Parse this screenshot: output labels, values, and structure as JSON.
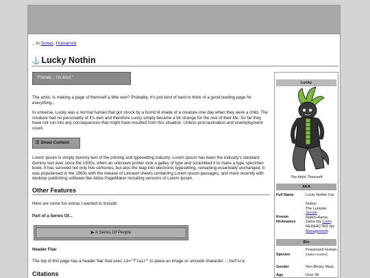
{
  "breadcrumb": {
    "prefix": "...In",
    "links": [
      "Sonas",
      "Humanoid"
    ],
    "separator": ","
  },
  "page": {
    "title": "Lucky Nothin",
    "title_icon": "anchor-icon"
  },
  "quote": "\"Friends... I'm tired.\"",
  "intro": {
    "p1": "The artist. Is making a page of themself a little vein? Probably. It's just kind of hard to think of a good landing page for",
    "p1_em": "everything...",
    "p2": "In universe, Lucky was a normal human that got struck by a horrid lil shade of a creature one day when they were a child. The creature had no personality of it's own and therefore Lucky simply became a bit strange for the rest of their life. So far they have not run into any consequences that might have resulted from this situation. Unless procrastination and unemployment count."
  },
  "show_button": "Show Content",
  "lorem": "Lorem Ipsum is simply dummy text of the printing and typesetting industry. Lorem Ipsum has been the industry's standard dummy text ever since the 1500s, when an unknown printer took a galley of type and scrambled it to make a type specimen book. It has survived not only five centuries, but also the leap into electronic typesetting, remaining essentially unchanged. It was popularised in the 1960s with the release of Letraset sheets containing Lorem Ipsum passages, and more recently with desktop publishing software like Aldus PageMaker including versions of Lorem Ipsum.",
  "other_features": {
    "heading": "Other Features",
    "text": "Here are some fun extras I wanted to include:",
    "series_label": "Part of a Series Of...",
    "series_button": "▶  A Series Of People",
    "flair_label": "Header Flair",
    "flair_pre": "The top of this page has a header flair that uses",
    "flair_code1": "id=\"flair\"",
    "flair_mid": "to place an image or unicode character",
    "flair_code2": "::before",
    "flair_end": "."
  },
  "citations_heading": "Citations",
  "infobox": {
    "title": "Lucky",
    "caption": "The Artist Themself",
    "aka_header": "AKA",
    "full_name_key": "Full Name",
    "full_name_val": "Lucky Nothin Cat",
    "nick_key": "Known Nicknames",
    "nick_lines": [
      "Nothin",
      "The Luckster"
    ],
    "nick_link1": "Scrunk",
    "nick_line3": "Nothin-Rama-Sama (by",
    "nick_link2": "Corn",
    "nick_line3_end": ")",
    "nick_line4": "REDEACTED (by",
    "nick_link3": "Management",
    "nick_line4_end": ")",
    "bio_header": "Bio",
    "species_key": "Species",
    "species_val": "Possessed Human",
    "species_note": "[citation needed]",
    "gender_key": "Gender",
    "gender_val": "Non-Binary Masc",
    "age_key": "Age",
    "age_val": "Over 38"
  },
  "colors": {
    "banner": "#a9a9a9",
    "link": "#1a0dab",
    "quote_bg": "#8a8a8a",
    "character_green": "#7dbb3c",
    "character_dark": "#2b2b2b"
  }
}
